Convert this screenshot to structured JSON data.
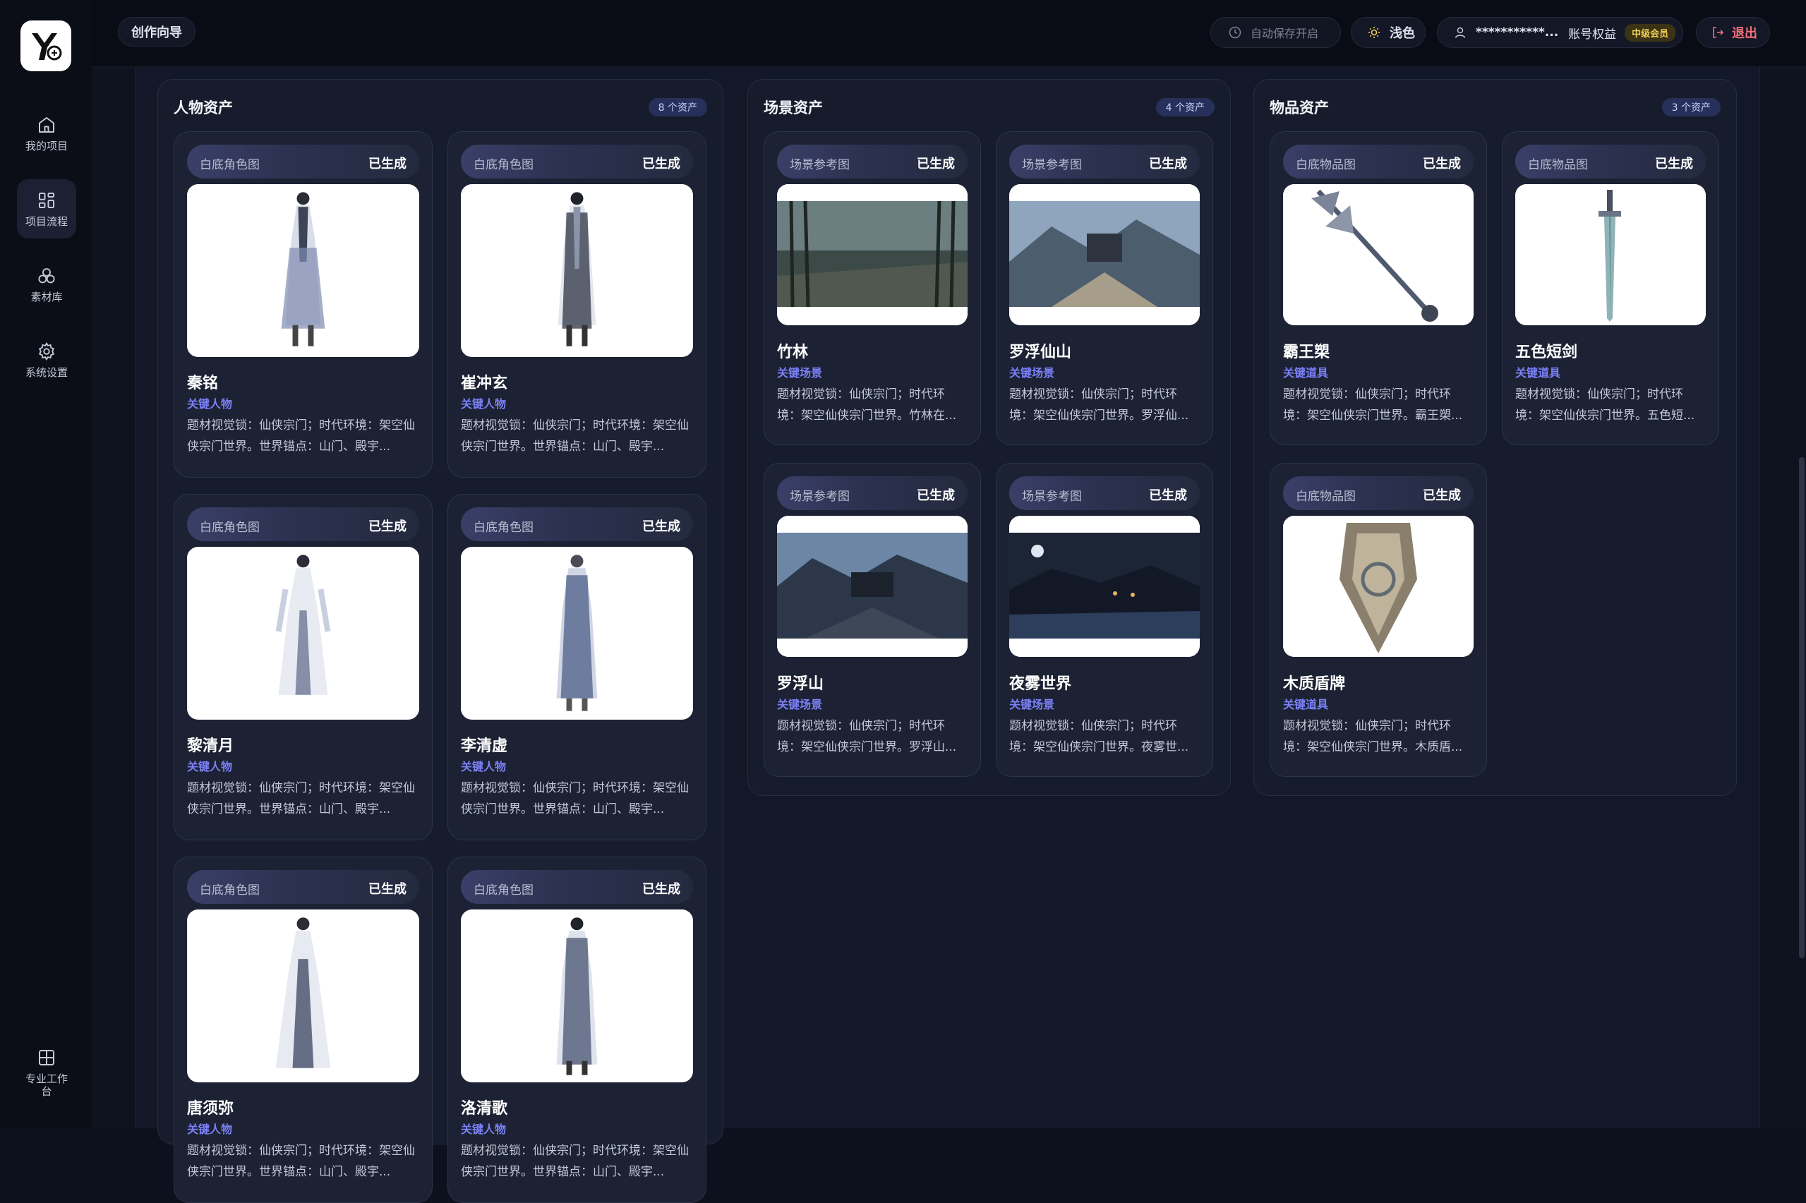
{
  "sidebar": {
    "logo_icon": "app-logo-icon",
    "items": [
      {
        "label": "我的项目",
        "icon": "home-icon"
      },
      {
        "label": "项目流程",
        "icon": "grid-icon",
        "active": true
      },
      {
        "label": "素材库",
        "icon": "cubes-icon"
      },
      {
        "label": "系统设置",
        "icon": "gear-icon"
      }
    ],
    "bottom_item": {
      "label": "专业工作台",
      "icon": "workbench-icon"
    }
  },
  "header": {
    "wizard_label": "创作向导",
    "autosave_label": "自动保存开启",
    "theme_label": "浅色",
    "username": "***********...",
    "account_label": "账号权益",
    "member_badge": "中级会员",
    "logout_label": "退出"
  },
  "sections": {
    "characters": {
      "title": "人物资产",
      "count": "8 个资产",
      "items": [
        {
          "type": "白底角色图",
          "status": "已生成",
          "name": "秦铭",
          "category": "关键人物",
          "desc": "题材视觉锁：仙侠宗门；时代环境：架空仙侠宗门世界。世界锚点：山门、殿宇..."
        },
        {
          "type": "白底角色图",
          "status": "已生成",
          "name": "崔冲玄",
          "category": "关键人物",
          "desc": "题材视觉锁：仙侠宗门；时代环境：架空仙侠宗门世界。世界锚点：山门、殿宇..."
        },
        {
          "type": "白底角色图",
          "status": "已生成",
          "name": "黎清月",
          "category": "关键人物",
          "desc": "题材视觉锁：仙侠宗门；时代环境：架空仙侠宗门世界。世界锚点：山门、殿宇..."
        },
        {
          "type": "白底角色图",
          "status": "已生成",
          "name": "李清虚",
          "category": "关键人物",
          "desc": "题材视觉锁：仙侠宗门；时代环境：架空仙侠宗门世界。世界锚点：山门、殿宇..."
        },
        {
          "type": "白底角色图",
          "status": "已生成",
          "name": "唐须弥",
          "category": "关键人物",
          "desc": "题材视觉锁：仙侠宗门；时代环境：架空仙侠宗门世界。世界锚点：山门、殿宇..."
        },
        {
          "type": "白底角色图",
          "status": "已生成",
          "name": "洛清歌",
          "category": "关键人物",
          "desc": "题材视觉锁：仙侠宗门；时代环境：架空仙侠宗门世界。世界锚点：山门、殿宇..."
        }
      ]
    },
    "scenes": {
      "title": "场景资产",
      "count": "4 个资产",
      "items": [
        {
          "type": "场景参考图",
          "status": "已生成",
          "name": "竹林",
          "category": "关键场景",
          "desc": "题材视觉锁：仙侠宗门；时代环境：架空仙侠宗门世界。竹林在..."
        },
        {
          "type": "场景参考图",
          "status": "已生成",
          "name": "罗浮仙山",
          "category": "关键场景",
          "desc": "题材视觉锁：仙侠宗门；时代环境：架空仙侠宗门世界。罗浮仙..."
        },
        {
          "type": "场景参考图",
          "status": "已生成",
          "name": "罗浮山",
          "category": "关键场景",
          "desc": "题材视觉锁：仙侠宗门；时代环境：架空仙侠宗门世界。罗浮山..."
        },
        {
          "type": "场景参考图",
          "status": "已生成",
          "name": "夜雾世界",
          "category": "关键场景",
          "desc": "题材视觉锁：仙侠宗门；时代环境：架空仙侠宗门世界。夜雾世..."
        }
      ]
    },
    "props": {
      "title": "物品资产",
      "count": "3 个资产",
      "items": [
        {
          "type": "白底物品图",
          "status": "已生成",
          "name": "霸王槊",
          "category": "关键道具",
          "desc": "题材视觉锁：仙侠宗门；时代环境：架空仙侠宗门世界。霸王槊..."
        },
        {
          "type": "白底物品图",
          "status": "已生成",
          "name": "五色短剑",
          "category": "关键道具",
          "desc": "题材视觉锁：仙侠宗门；时代环境：架空仙侠宗门世界。五色短..."
        },
        {
          "type": "白底物品图",
          "status": "已生成",
          "name": "木质盾牌",
          "category": "关键道具",
          "desc": "题材视觉锁：仙侠宗门；时代环境：架空仙侠宗门世界。木质盾..."
        }
      ]
    }
  },
  "colors": {
    "accent": "#7b80f6",
    "background": "#0d111d",
    "card": "#1c2233",
    "member_badge": "#f1cf55",
    "logout": "#f0707a"
  }
}
